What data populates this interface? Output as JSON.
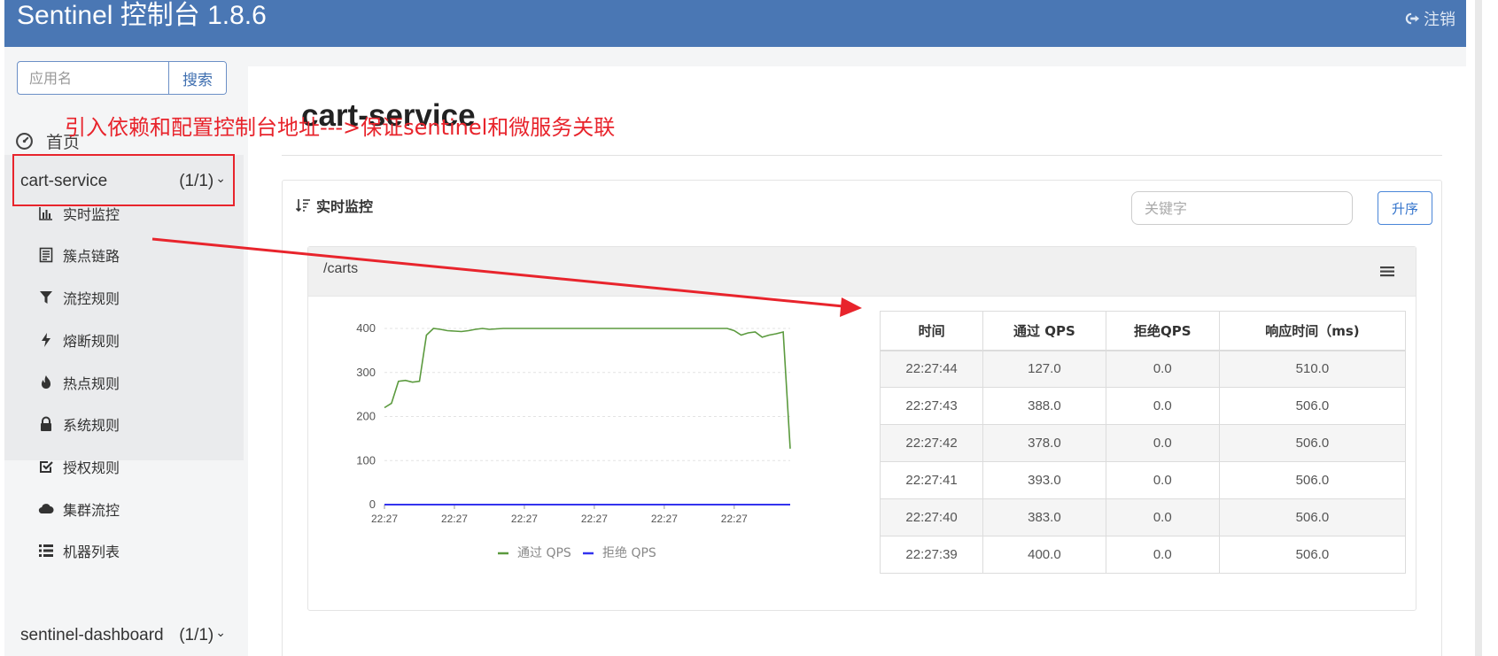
{
  "header": {
    "title": "Sentinel 控制台 1.8.6",
    "logout_label": "注销"
  },
  "sidebar": {
    "search": {
      "placeholder": "应用名",
      "button_label": "搜索"
    },
    "home_label": "首页",
    "apps": [
      {
        "name": "cart-service",
        "count": "(1/1)"
      },
      {
        "name": "sentinel-dashboard",
        "count": "(1/1)"
      }
    ],
    "menu": [
      {
        "label": "实时监控",
        "icon": "bar-chart-icon"
      },
      {
        "label": "簇点链路",
        "icon": "list-doc-icon"
      },
      {
        "label": "流控规则",
        "icon": "filter-icon"
      },
      {
        "label": "熔断规则",
        "icon": "lightning-icon"
      },
      {
        "label": "热点规则",
        "icon": "fire-icon"
      },
      {
        "label": "系统规则",
        "icon": "lock-icon"
      },
      {
        "label": "授权规则",
        "icon": "check-square-icon"
      },
      {
        "label": "集群流控",
        "icon": "cloud-icon"
      },
      {
        "label": "机器列表",
        "icon": "list-icon"
      }
    ]
  },
  "main": {
    "page_title": "cart-service",
    "panel_title": "实时监控",
    "keyword_placeholder": "关键字",
    "sort_label": "升序",
    "resource": "/carts"
  },
  "table": {
    "headers": [
      "时间",
      "通过 QPS",
      "拒绝QPS",
      "响应时间（ms)"
    ],
    "rows": [
      [
        "22:27:44",
        "127.0",
        "0.0",
        "510.0"
      ],
      [
        "22:27:43",
        "388.0",
        "0.0",
        "506.0"
      ],
      [
        "22:27:42",
        "378.0",
        "0.0",
        "506.0"
      ],
      [
        "22:27:41",
        "393.0",
        "0.0",
        "506.0"
      ],
      [
        "22:27:40",
        "383.0",
        "0.0",
        "506.0"
      ],
      [
        "22:27:39",
        "400.0",
        "0.0",
        "506.0"
      ]
    ]
  },
  "annotation": {
    "text": "引入依赖和配置控制台地址--->保证sentinel和微服务关联",
    "color": "#e8242c"
  },
  "colors": {
    "header_bg": "#4a77b4",
    "pass_series": "#5b9a3e",
    "block_series": "#3333ee",
    "annotation": "#e8242c"
  },
  "chart_data": {
    "type": "line",
    "x": [
      0,
      1,
      2,
      3,
      4,
      5,
      6,
      7,
      8,
      9,
      10,
      11,
      12,
      13,
      14,
      15,
      16,
      17,
      18,
      19,
      20,
      21,
      22,
      23,
      24,
      25,
      26,
      27,
      28,
      29,
      30,
      31,
      32,
      33,
      34,
      35,
      36,
      37,
      38,
      39,
      40,
      41,
      42,
      43,
      44,
      45,
      46,
      47,
      48,
      49,
      50,
      51,
      52,
      53,
      54,
      55,
      56,
      57,
      58
    ],
    "xticks": [
      "22:27",
      "22:27",
      "22:27",
      "22:27",
      "22:27",
      "22:27"
    ],
    "series": [
      {
        "name": "通过 QPS",
        "color": "#5b9a3e",
        "values": [
          220,
          230,
          280,
          282,
          278,
          280,
          385,
          400,
          398,
          395,
          394,
          393,
          395,
          398,
          400,
          398,
          399,
          400,
          400,
          400,
          400,
          400,
          400,
          400,
          400,
          400,
          400,
          400,
          400,
          400,
          400,
          400,
          400,
          400,
          400,
          400,
          400,
          400,
          400,
          400,
          400,
          400,
          400,
          400,
          400,
          400,
          400,
          400,
          400,
          400,
          395,
          385,
          390,
          392,
          380,
          385,
          388,
          392,
          127
        ]
      },
      {
        "name": "拒绝 QPS",
        "color": "#3333ee",
        "values": [
          0,
          0,
          0,
          0,
          0,
          0,
          0,
          0,
          0,
          0,
          0,
          0,
          0,
          0,
          0,
          0,
          0,
          0,
          0,
          0,
          0,
          0,
          0,
          0,
          0,
          0,
          0,
          0,
          0,
          0,
          0,
          0,
          0,
          0,
          0,
          0,
          0,
          0,
          0,
          0,
          0,
          0,
          0,
          0,
          0,
          0,
          0,
          0,
          0,
          0,
          0,
          0,
          0,
          0,
          0,
          0,
          0,
          0,
          0
        ]
      }
    ],
    "yticks": [
      0,
      100,
      200,
      300,
      400
    ],
    "ylim": [
      0,
      400
    ],
    "grid": true,
    "legend": "bottom"
  }
}
